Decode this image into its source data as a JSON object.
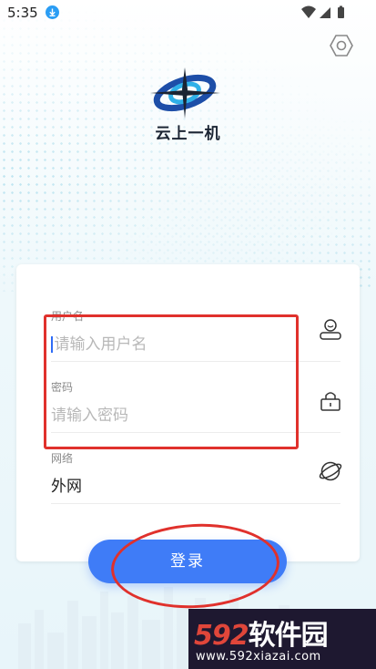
{
  "status_bar": {
    "time": "5:35"
  },
  "app": {
    "name": "云上一机"
  },
  "form": {
    "username": {
      "label": "用户名",
      "placeholder": "请输入用户名"
    },
    "password": {
      "label": "密码",
      "placeholder": "请输入密码"
    },
    "network": {
      "label": "网络",
      "value": "外网"
    }
  },
  "login_button": {
    "label": "登录"
  },
  "watermark": {
    "brand_num": "592",
    "brand_text": "软件园",
    "url": "www.592xiazai.com"
  },
  "colors": {
    "accent": "#3f7cf7",
    "annotation": "#e0312c",
    "watermark_bg": "#1e1830"
  },
  "icons": [
    "download-icon",
    "wifi-icon",
    "signal-icon",
    "battery-icon",
    "settings-icon",
    "user-icon",
    "lock-icon",
    "globe-icon"
  ]
}
